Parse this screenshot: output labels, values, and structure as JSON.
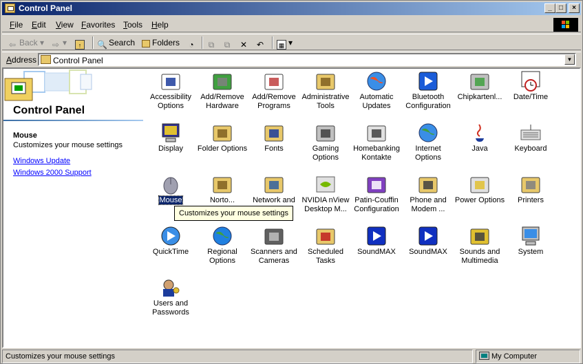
{
  "window": {
    "title": "Control Panel",
    "min_glyph": "_",
    "max_glyph": "□",
    "close_glyph": "×"
  },
  "menu": [
    "File",
    "Edit",
    "View",
    "Favorites",
    "Tools",
    "Help"
  ],
  "toolbar": {
    "back_label": "Back",
    "search_label": "Search",
    "folders_label": "Folders"
  },
  "address": {
    "label": "Address",
    "value": "Control Panel"
  },
  "left_pane": {
    "title": "Control Panel",
    "selected_name": "Mouse",
    "selected_desc": "Customizes your mouse settings",
    "links": [
      "Windows Update",
      "Windows 2000 Support"
    ]
  },
  "items": [
    {
      "line1": "Accessibility",
      "line2": "Options",
      "icon": "accessibility-icon"
    },
    {
      "line1": "Add/Remove",
      "line2": "Hardware",
      "icon": "add-remove-hardware-icon"
    },
    {
      "line1": "Add/Remove",
      "line2": "Programs",
      "icon": "add-remove-programs-icon"
    },
    {
      "line1": "Administrative",
      "line2": "Tools",
      "icon": "administrative-tools-icon"
    },
    {
      "line1": "Automatic",
      "line2": "Updates",
      "icon": "automatic-updates-icon"
    },
    {
      "line1": "Bluetooth",
      "line2": "Configuration",
      "icon": "bluetooth-icon"
    },
    {
      "line1": "Chipkartenl...",
      "line2": "",
      "icon": "smartcard-reader-icon"
    },
    {
      "line1": "Date/Time",
      "line2": "",
      "icon": "date-time-icon"
    },
    {
      "line1": "Display",
      "line2": "",
      "icon": "display-icon"
    },
    {
      "line1": "Folder Options",
      "line2": "",
      "icon": "folder-options-icon"
    },
    {
      "line1": "Fonts",
      "line2": "",
      "icon": "fonts-icon"
    },
    {
      "line1": "Gaming",
      "line2": "Options",
      "icon": "gaming-options-icon"
    },
    {
      "line1": "Homebanking",
      "line2": "Kontakte",
      "icon": "homebanking-icon"
    },
    {
      "line1": "Internet",
      "line2": "Options",
      "icon": "internet-options-icon"
    },
    {
      "line1": "Java",
      "line2": "",
      "icon": "java-icon"
    },
    {
      "line1": "Keyboard",
      "line2": "",
      "icon": "keyboard-icon"
    },
    {
      "line1": "Mouse",
      "line2": "",
      "icon": "mouse-icon"
    },
    {
      "line1": "Norto...",
      "line2": "",
      "icon": "norton-icon"
    },
    {
      "line1": "Network and",
      "line2": "Dial-up ...",
      "icon": "network-icon"
    },
    {
      "line1": "NVIDIA nView",
      "line2": "Desktop M...",
      "icon": "nvidia-icon"
    },
    {
      "line1": "Patin-Couffin",
      "line2": "Configuration",
      "icon": "patin-couffin-icon"
    },
    {
      "line1": "Phone and",
      "line2": "Modem ...",
      "icon": "phone-modem-icon"
    },
    {
      "line1": "Power Options",
      "line2": "",
      "icon": "power-options-icon"
    },
    {
      "line1": "Printers",
      "line2": "",
      "icon": "printers-icon"
    },
    {
      "line1": "QuickTime",
      "line2": "",
      "icon": "quicktime-icon"
    },
    {
      "line1": "Regional",
      "line2": "Options",
      "icon": "regional-options-icon"
    },
    {
      "line1": "Scanners and",
      "line2": "Cameras",
      "icon": "scanners-cameras-icon"
    },
    {
      "line1": "Scheduled",
      "line2": "Tasks",
      "icon": "scheduled-tasks-icon"
    },
    {
      "line1": "SoundMAX",
      "line2": "",
      "icon": "soundmax-icon"
    },
    {
      "line1": "SoundMAX",
      "line2": "",
      "icon": "soundmax-icon"
    },
    {
      "line1": "Sounds and",
      "line2": "Multimedia",
      "icon": "sounds-multimedia-icon"
    },
    {
      "line1": "System",
      "line2": "",
      "icon": "system-icon"
    },
    {
      "line1": "Users and",
      "line2": "Passwords",
      "icon": "users-passwords-icon"
    }
  ],
  "tooltip": "Customizes your mouse settings",
  "status": {
    "left": "Customizes your mouse settings",
    "right": "My Computer"
  }
}
